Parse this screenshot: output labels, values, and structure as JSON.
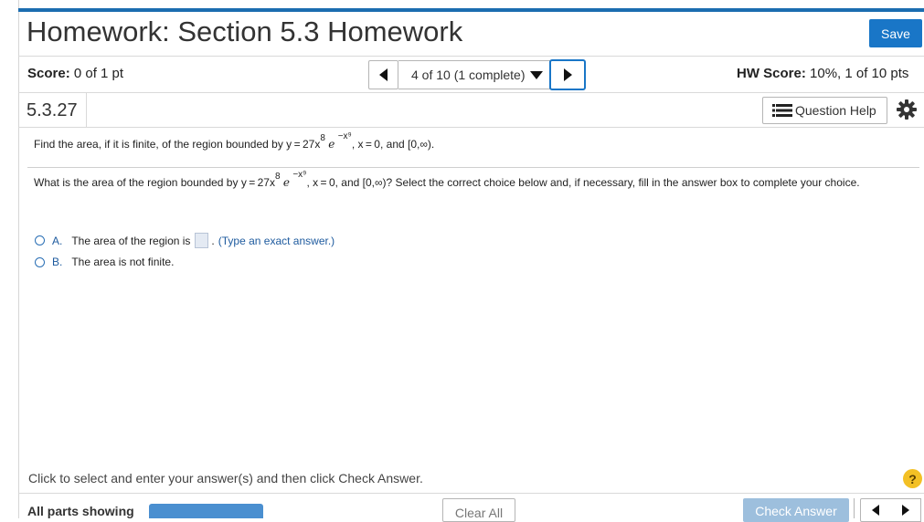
{
  "header": {
    "title": "Homework: Section 5.3 Homework",
    "save_label": "Save"
  },
  "status": {
    "score_label": "Score:",
    "score_value": "0 of 1 pt",
    "question_nav": "4 of 10 (1 complete)",
    "hw_score_label": "HW Score:",
    "hw_score_value": "10%, 1 of 10 pts"
  },
  "question": {
    "number": "5.3.27",
    "help_label": "Question Help",
    "problem_prefix": "Find the area, if it is finite, of the region bounded by y = 27x",
    "problem_exp_x": "8",
    "problem_e": "e",
    "problem_exp_e": "−x⁹",
    "problem_suffix": ", x = 0, and [0,∞).",
    "prompt_prefix": "What is the area of the region bounded by y = 27x",
    "prompt_exp_x": "8",
    "prompt_e": "e",
    "prompt_exp_e": "−x⁹",
    "prompt_suffix": ", x = 0, and [0,∞)? Select the correct choice below and, if necessary, fill in the answer box to complete your choice."
  },
  "choices": [
    {
      "letter": "A.",
      "text_before": "The area of the region is",
      "text_after": ".",
      "hint": "(Type an exact answer.)"
    },
    {
      "letter": "B.",
      "text": "The area is not finite."
    }
  ],
  "footer": {
    "instructions": "Click to select and enter your answer(s) and then click Check Answer.",
    "help_symbol": "?",
    "all_parts_label": "All parts showing",
    "clear_label": "Clear All",
    "check_label": "Check Answer"
  },
  "colors": {
    "accent": "#1976c7",
    "choice_text": "#1d5a9e",
    "check_disabled": "#9dbfdd",
    "help_circle": "#f3c025"
  },
  "icons": [
    "triangle-left-icon",
    "triangle-right-icon",
    "caret-down-icon",
    "list-icon",
    "gear-icon",
    "question-circle-icon"
  ]
}
